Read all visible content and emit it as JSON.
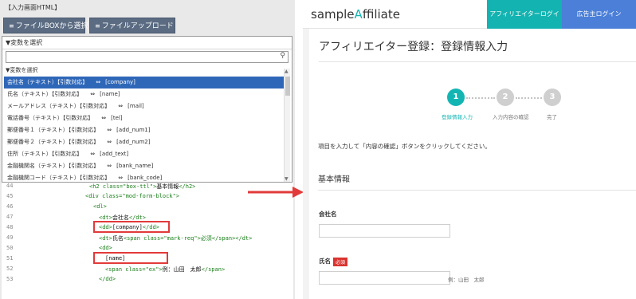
{
  "editor": {
    "title": "【入力画面HTML】",
    "buttons": {
      "select_from_box": "ファイルBOXから選択",
      "file_upload": "ファイルアップロード",
      "icon": "≡"
    },
    "dropdown": {
      "header": "▼変数を選択",
      "group_label": "▼変数を選択",
      "search_placeholder": "",
      "items": [
        {
          "label": "会社名（テキスト）【引数対応】",
          "arrow": "⇔",
          "var": "[company]"
        },
        {
          "label": "氏名（テキスト）【引数対応】",
          "arrow": "⇔",
          "var": "[name]"
        },
        {
          "label": "メールアドレス（テキスト）【引数対応】",
          "arrow": "⇔",
          "var": "[mail]"
        },
        {
          "label": "電話番号（テキスト）【引数対応】",
          "arrow": "⇔",
          "var": "[tel]"
        },
        {
          "label": "郵便番号１（テキスト）【引数対応】",
          "arrow": "⇔",
          "var": "[add_num1]"
        },
        {
          "label": "郵便番号２（テキスト）【引数対応】",
          "arrow": "⇔",
          "var": "[add_num2]"
        },
        {
          "label": "住所（テキスト）【引数対応】",
          "arrow": "⇔",
          "var": "[add_text]"
        },
        {
          "label": "金融機関名（テキスト）【引数対応】",
          "arrow": "⇔",
          "var": "[bank_name]"
        },
        {
          "label": "金融機関コード（テキスト）【引数対応】",
          "arrow": "⇔",
          "var": "[bank_code]"
        }
      ]
    },
    "code_lines": [
      {
        "num": "44",
        "a": "<h2 class=\"box-ttl\">",
        "b": "基本情報",
        "c": "</h2>"
      },
      {
        "num": "45",
        "a": "<div class=\"mod-form-block\">",
        "b": "",
        "c": ""
      },
      {
        "num": "46",
        "a": "<dl>",
        "b": "",
        "c": ""
      },
      {
        "num": "47",
        "a": "<dt>",
        "b": "会社名",
        "c": "</dt>"
      },
      {
        "num": "48",
        "a": "<dd>",
        "b": "[company]",
        "c": "</dd>"
      },
      {
        "num": "49",
        "a": "<dt>",
        "b": "氏名",
        "c": "<span class=\"mark-req\">必須</span></dt>"
      },
      {
        "num": "50",
        "a": "<dd>",
        "b": "",
        "c": ""
      },
      {
        "num": "51",
        "a": "",
        "b": "[name]",
        "c": ""
      },
      {
        "num": "52",
        "a": "<span class=\"ex\">",
        "b": "例：山田　太郎",
        "c": "</span>"
      },
      {
        "num": "53",
        "a": "</dd>",
        "b": "",
        "c": ""
      }
    ]
  },
  "site": {
    "logo_prefix": "sample",
    "logo_accent": "A",
    "logo_suffix": "ffiliate",
    "affiliate_login": "アフィリエイターログイン",
    "advertiser_login": "広告主ログイン",
    "page_title": "アフィリエイター登録：登録情報入力",
    "steps": [
      {
        "num": "1",
        "label": "登録情報入力"
      },
      {
        "num": "2",
        "label": "入力内容の確認"
      },
      {
        "num": "3",
        "label": "完了"
      }
    ],
    "instruction": "項目を入力して「内容の確認」ボタンをクリックしてください。",
    "section_title": "基本情報",
    "fields": {
      "company_label": "会社名",
      "name_label": "氏名",
      "required_badge": "必須",
      "name_example": "例：山田　太郎"
    }
  },
  "colors": {
    "accent_teal": "#13b5b3",
    "advertiser_blue": "#4b7fd8",
    "selection_blue": "#2f67b8",
    "highlight_red": "#e23a3a",
    "required_red": "#d9332f"
  }
}
